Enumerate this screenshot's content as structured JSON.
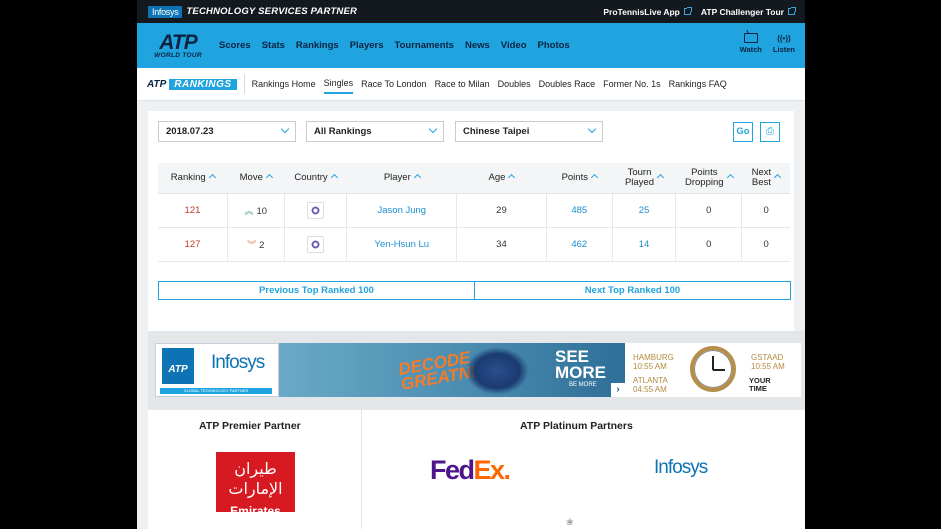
{
  "topbar": {
    "partner_chip": "Infosys",
    "partner_text": "TECHNOLOGY SERVICES PARTNER",
    "links": [
      "ProTennisLive App",
      "ATP Challenger Tour"
    ]
  },
  "nav": {
    "logo_main": "ATP",
    "logo_sub": "WORLD TOUR",
    "items": [
      "Scores",
      "Stats",
      "Rankings",
      "Players",
      "Tournaments",
      "News",
      "Video",
      "Photos"
    ],
    "watch": "Watch",
    "listen": "Listen",
    "listen_icon": "((•))"
  },
  "subnav": {
    "logo_atp": "ATP",
    "logo_rankings": "RANKINGS",
    "items": [
      "Rankings Home",
      "Singles",
      "Race To London",
      "Race to Milan",
      "Doubles",
      "Doubles Race",
      "Former No. 1s",
      "Rankings FAQ"
    ],
    "active": "Singles"
  },
  "filters": {
    "date": "2018.07.23",
    "range": "All Rankings",
    "country": "Chinese Taipei",
    "go": "Go",
    "print_icon": "⎙"
  },
  "table": {
    "headers": {
      "ranking": "Ranking",
      "move": "Move",
      "country": "Country",
      "player": "Player",
      "age": "Age",
      "points": "Points",
      "tourn_played_1": "Tourn",
      "tourn_played_2": "Played",
      "points_dropping_1": "Points",
      "points_dropping_2": "Dropping",
      "next_best_1": "Next",
      "next_best_2": "Best"
    },
    "rows": [
      {
        "ranking": "121",
        "move_dir": "up",
        "move_icon": "≈",
        "move": "10",
        "player": "Jason Jung",
        "age": "29",
        "points": "485",
        "tourn": "25",
        "dropping": "0",
        "next_best": "0"
      },
      {
        "ranking": "127",
        "move_dir": "down",
        "move_icon": "≈",
        "move": "2",
        "player": "Yen-Hsun Lu",
        "age": "34",
        "points": "462",
        "tourn": "14",
        "dropping": "0",
        "next_best": "0"
      }
    ]
  },
  "pager": {
    "prev": "Previous Top Ranked 100",
    "next": "Next Top Ranked 100"
  },
  "banner": {
    "left_atp": "ATP",
    "left_infosys": "Infosys",
    "left_strip": "GLOBAL TECHNOLOGY PARTNER",
    "decode_1": "DECODE",
    "decode_2": "GREATNESS",
    "see_more": "SEE",
    "see_more_2": "MORE",
    "be_more": "BE MORE",
    "arrow": "›",
    "hamburg": "HAMBURG",
    "hamburg_time": "10:55 AM",
    "atlanta": "ATLANTA",
    "atlanta_time": "04:55 AM",
    "gstaad": "GSTAAD",
    "gstaad_time": "10:55 AM",
    "your_time_1": "YOUR",
    "your_time_2": "TIME"
  },
  "partners": {
    "premier_title": "ATP Premier Partner",
    "platinum_title": "ATP Platinum Partners",
    "emirates_ar": "طيران الإمارات",
    "emirates_en": "Emirates",
    "fedex_fed": "Fed",
    "fedex_ex": "Ex.",
    "infosys": "Infosys"
  },
  "colors": {
    "nav_blue": "#1fa4e0",
    "dark_navy": "#0c2340",
    "rank_red": "#c0392b"
  }
}
